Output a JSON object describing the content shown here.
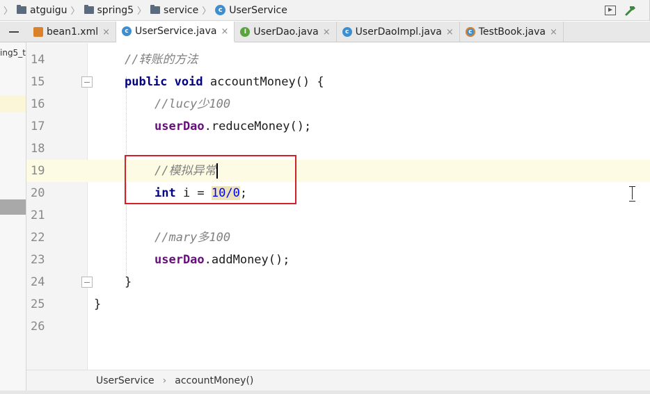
{
  "breadcrumb": {
    "items": [
      "atguigu",
      "spring5",
      "service",
      "UserService"
    ]
  },
  "tabs": [
    {
      "label": "bean1.xml",
      "icon": "xml-file-icon",
      "active": false
    },
    {
      "label": "UserService.java",
      "icon": "class-icon",
      "active": true
    },
    {
      "label": "UserDao.java",
      "icon": "interface-icon",
      "active": false
    },
    {
      "label": "UserDaoImpl.java",
      "icon": "class-icon",
      "active": false
    },
    {
      "label": "TestBook.java",
      "icon": "test-class-icon",
      "active": false
    }
  ],
  "tab_close_glyph": "×",
  "project_panel": {
    "label": "ing5_t"
  },
  "editor": {
    "lines": [
      {
        "num": "14",
        "text": "//转账的方法"
      },
      {
        "num": "15",
        "text": "public void accountMoney() {"
      },
      {
        "num": "16",
        "text": "//lucy少100"
      },
      {
        "num": "17",
        "text": "userDao.reduceMoney();"
      },
      {
        "num": "18",
        "text": ""
      },
      {
        "num": "19",
        "text": "//模拟异常"
      },
      {
        "num": "20",
        "text": "int i = 10/0;"
      },
      {
        "num": "21",
        "text": ""
      },
      {
        "num": "22",
        "text": "//mary多100"
      },
      {
        "num": "23",
        "text": "userDao.addMoney();"
      },
      {
        "num": "24",
        "text": "}"
      },
      {
        "num": "25",
        "text": "}"
      },
      {
        "num": "26",
        "text": ""
      }
    ],
    "tokens": {
      "l14_comment": "//转账的方法",
      "l15_public": "public",
      "l15_void": "void",
      "l15_rest": " accountMoney() {",
      "l16_comment": "//lucy少100",
      "l17_field": "userDao",
      "l17_rest": ".reduceMoney();",
      "l19_comment": "//模拟异常",
      "l20_int": "int",
      "l20_mid": " i = ",
      "l20_num": "10/0",
      "l20_end": ";",
      "l22_comment": "//mary多100",
      "l23_field": "userDao",
      "l23_rest": ".addMoney();",
      "l24_brace": "}",
      "l25_brace": "}"
    }
  },
  "status_breadcrumb": {
    "class": "UserService",
    "separator": "›",
    "method": "accountMoney()"
  },
  "colors": {
    "keyword": "#000080",
    "comment": "#808080",
    "field": "#660e7a",
    "number": "#0000ff",
    "current_line": "#fefbe5",
    "annotation_box": "#d32029"
  }
}
